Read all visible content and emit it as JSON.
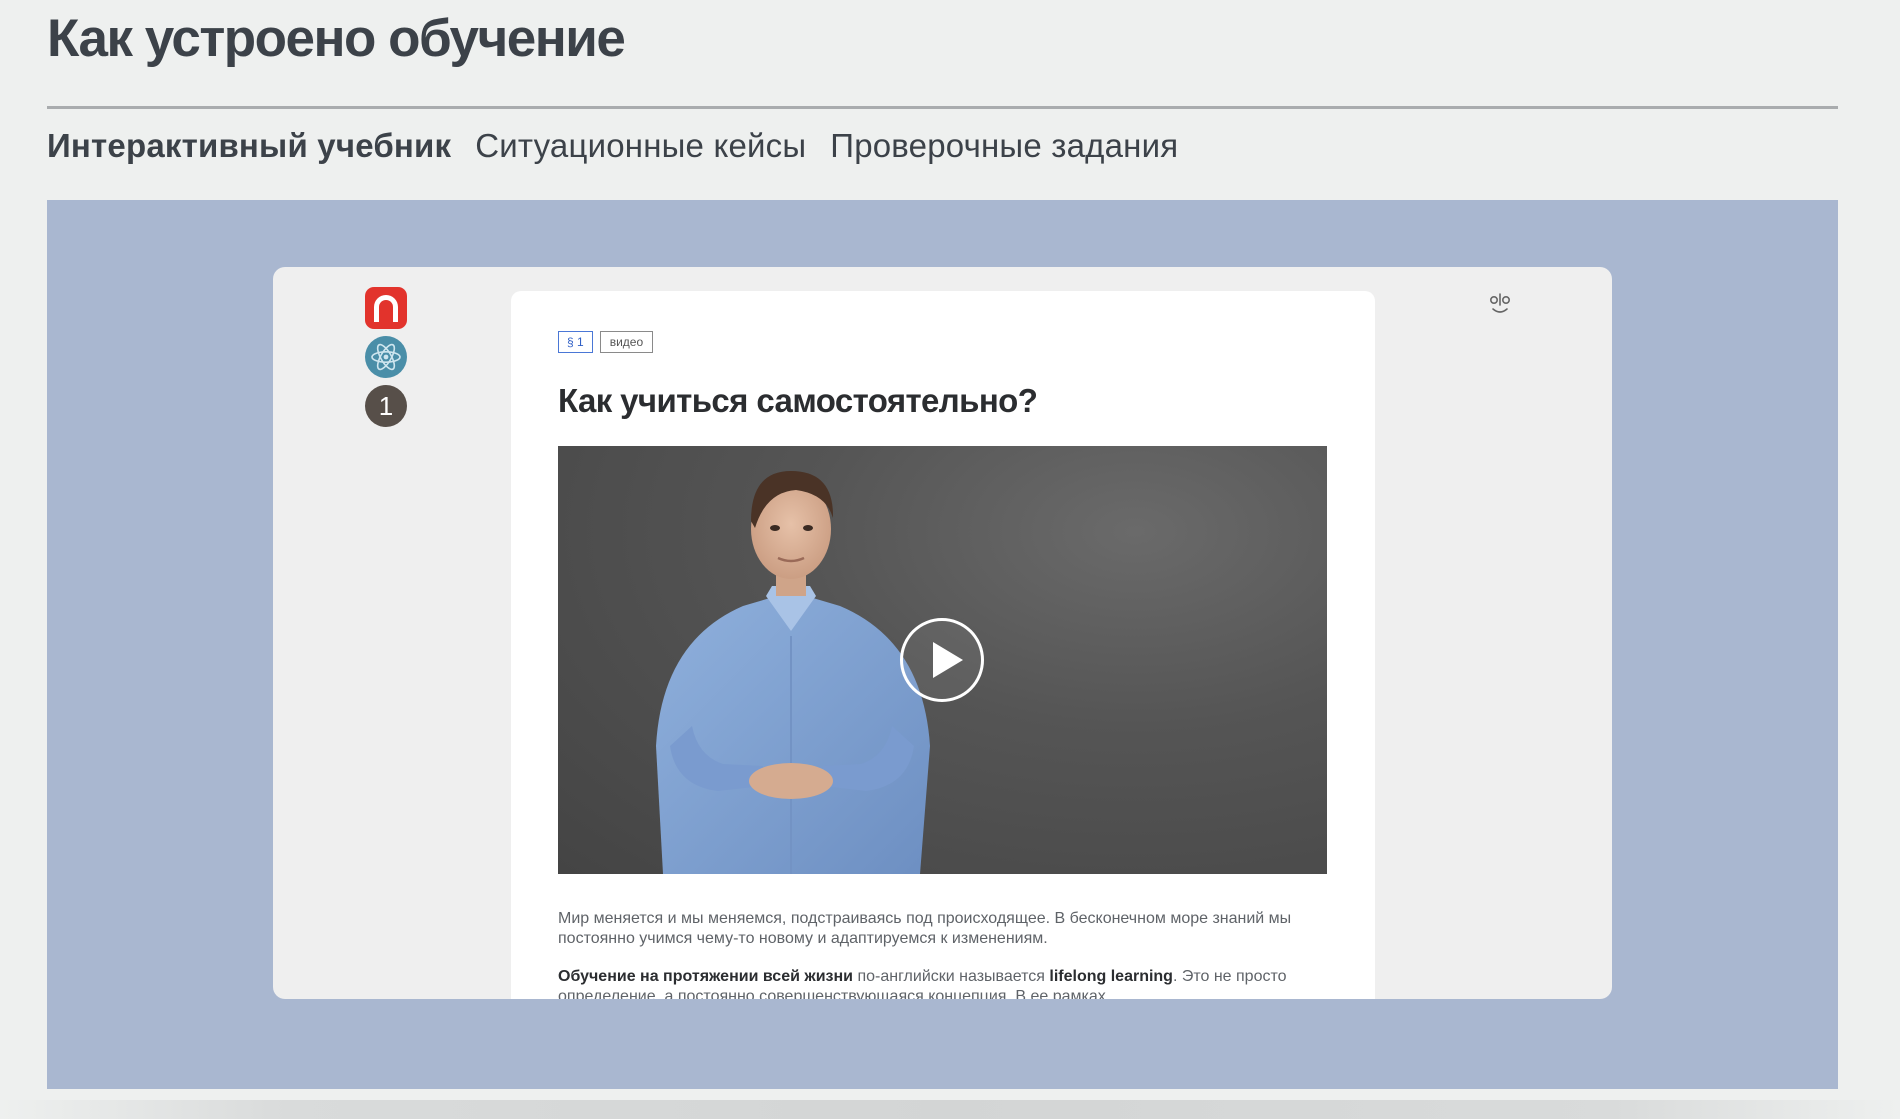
{
  "page": {
    "title": "Как устроено обучение"
  },
  "tabs": [
    {
      "label": "Интерактивный учебник",
      "active": true
    },
    {
      "label": "Ситуационные кейсы",
      "active": false
    },
    {
      "label": "Проверочные задания",
      "active": false
    }
  ],
  "preview": {
    "sidebar": {
      "icons": [
        "brand-logo-icon",
        "atom-icon"
      ],
      "badge_number": "1"
    },
    "reader_icon": "reader-mode-icon",
    "article": {
      "tags": {
        "section": "§ 1",
        "type": "видео"
      },
      "title": "Как учиться самостоятельно?",
      "video": {
        "play_icon": "play-icon"
      },
      "paragraph1": "Мир меняется и мы меняемся, подстраиваясь под происходящее. В бесконечном море знаний мы постоянно учимся чему-то новому и адаптируемся  к изменениям.",
      "paragraph2": {
        "bold1": "Обучение на протяжении всей жизни",
        "text1": " по-английски называется ",
        "bold2": "lifelong learning",
        "text2": ". Это не просто определение, а постоянно совершенствующаяся концепция. В ее рамках"
      }
    }
  },
  "colors": {
    "page_bg": "#eef0ef",
    "stage_bg": "#a9b7d0",
    "brand_red": "#e2332c",
    "atom_blue": "#4a8ea8",
    "badge_brown": "#574f49",
    "tag_blue": "#2f5fc6"
  }
}
